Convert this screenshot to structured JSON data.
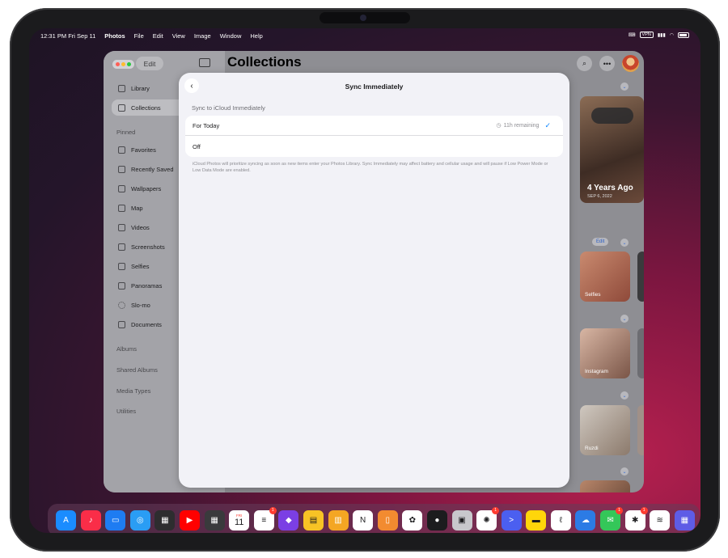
{
  "menubar": {
    "time": "12:31 PM",
    "date": "Fri Sep 11",
    "app": "Photos",
    "menus": [
      "File",
      "Edit",
      "View",
      "Image",
      "Window",
      "Help"
    ],
    "vpn": "VPN"
  },
  "photos": {
    "edit_label": "Edit",
    "title": "Collections",
    "sidebar": {
      "items": [
        {
          "label": "Library"
        },
        {
          "label": "Collections"
        }
      ],
      "pinned_heading": "Pinned",
      "pinned": [
        {
          "label": "Favorites"
        },
        {
          "label": "Recently Saved"
        },
        {
          "label": "Wallpapers"
        },
        {
          "label": "Map"
        },
        {
          "label": "Videos"
        },
        {
          "label": "Screenshots"
        },
        {
          "label": "Selfies"
        },
        {
          "label": "Panoramas"
        },
        {
          "label": "Slo-mo"
        },
        {
          "label": "Documents"
        }
      ],
      "sections": [
        "Albums",
        "Shared Albums",
        "Media Types",
        "Utilities"
      ]
    },
    "memory": {
      "title": "4 Years Ago",
      "date": "SEP 6, 2022"
    },
    "thumb_labels": [
      "Selfies",
      "Instagram",
      "Ruzdi"
    ],
    "mini_edit": "Edit"
  },
  "sheet": {
    "title": "Sync Immediately",
    "section_header": "Sync to iCloud Immediately",
    "options": [
      {
        "label": "For Today",
        "detail": "11h remaining",
        "selected": true
      },
      {
        "label": "Off",
        "detail": "",
        "selected": false
      }
    ],
    "footer": "iCloud Photos will prioritize syncing as soon as new items enter your Photos Library. Sync Immediately may affect battery and cellular usage and will pause if Low Power Mode or Low Data Mode are enabled."
  },
  "dock": {
    "calendar_day": "11",
    "calendar_weekday": "FRI",
    "apps": [
      {
        "name": "app-store",
        "color": "#1a8cff",
        "glyph": "A"
      },
      {
        "name": "music",
        "color": "#fa2d48",
        "glyph": "♪"
      },
      {
        "name": "files",
        "color": "#1e7cf2",
        "glyph": "▭"
      },
      {
        "name": "safari",
        "color": "#2a9df4",
        "glyph": "◎"
      },
      {
        "name": "widgets",
        "color": "#2d2d2f",
        "glyph": "▦"
      },
      {
        "name": "youtube",
        "color": "#ff0000",
        "glyph": "▶"
      },
      {
        "name": "app-library",
        "color": "#3a3a3c",
        "glyph": "▦"
      },
      {
        "name": "calendar",
        "color": "#ffffff",
        "glyph": ""
      },
      {
        "name": "reminders",
        "color": "#ffffff",
        "glyph": "≡",
        "badge": "1"
      },
      {
        "name": "shortcuts",
        "color": "#7b3fe4",
        "glyph": "◆"
      },
      {
        "name": "stickies",
        "color": "#f7c325",
        "glyph": "▤"
      },
      {
        "name": "notes-app",
        "color": "#f4a623",
        "glyph": "▥"
      },
      {
        "name": "notion",
        "color": "#ffffff",
        "glyph": "N"
      },
      {
        "name": "mirror",
        "color": "#f28b30",
        "glyph": "▯"
      },
      {
        "name": "photos",
        "color": "#ffffff",
        "glyph": "✿"
      },
      {
        "name": "siri",
        "color": "#1c1c1e",
        "glyph": "●"
      },
      {
        "name": "preview",
        "color": "#c8c8cc",
        "glyph": "▣"
      },
      {
        "name": "chatgpt",
        "color": "#ffffff",
        "glyph": "✺",
        "badge": "1"
      },
      {
        "name": "terminal",
        "color": "#4b5ff0",
        "glyph": ">"
      },
      {
        "name": "notes",
        "color": "#ffd60a",
        "glyph": "▬"
      },
      {
        "name": "writing",
        "color": "#ffffff",
        "glyph": "ℓ"
      },
      {
        "name": "weather",
        "color": "#2c7be5",
        "glyph": "☁"
      },
      {
        "name": "messages",
        "color": "#34c759",
        "glyph": "✉",
        "badge": "1"
      },
      {
        "name": "slack",
        "color": "#ffffff",
        "glyph": "✱",
        "badge": "1"
      },
      {
        "name": "rss",
        "color": "#ffffff",
        "glyph": "≋"
      },
      {
        "name": "app-switcher",
        "color": "#5e5ce6",
        "glyph": "▦"
      }
    ]
  }
}
